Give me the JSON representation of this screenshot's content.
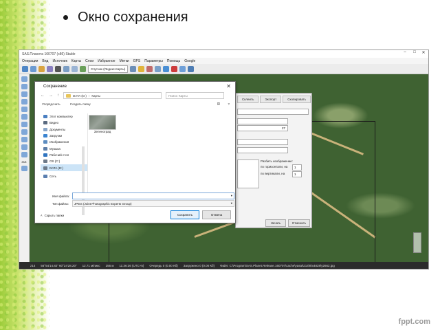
{
  "slide": {
    "title": "Окно сохранения"
  },
  "sas": {
    "window_title": "SAS.Планета 160707 (x86) Stable",
    "menu": [
      "Операции",
      "Вид",
      "Источник",
      "Карты",
      "Слои",
      "Избранное",
      "Метки",
      "GPS",
      "Параметры",
      "Помощь",
      "Google"
    ],
    "map_combo": "Спутник (Яндекс.Карты)",
    "zoom_label": "z14",
    "status": [
      "z14",
      "56°54'14.82\" 60°24'28.20\"",
      "12.71 м/пикс",
      "256 м",
      "11:36:36 (UTC+5)",
      "Очередь 0 (0.00 Кб)",
      "Загружено 0 (0.00 Кб)",
      "Файл: C:\\Program\\SAS.Planet.Release.160707\\cache\\yasat\\z14\\8\\x4828\\y2662.jpg"
    ]
  },
  "panel": {
    "tabs": [
      "Склеить",
      "Экспорт",
      "Скопировать"
    ],
    "split_label": "Разбить изображение:",
    "horiz_label": "по горизонтали, на",
    "vert_label": "по вертикали, на",
    "horiz_value": "1",
    "vert_value": "1",
    "z_value": "27",
    "start_button": "Начать",
    "cancel_button": "Отменить"
  },
  "dialog": {
    "title": "Сохранение",
    "breadcrumb": [
      "DATA (D:)",
      "Карты"
    ],
    "search_placeholder": "Поиск: Карты",
    "organize": "Упорядочить",
    "new_folder": "Создать папку",
    "tree": [
      {
        "label": "Этот компьютер",
        "icon": "computer-icon",
        "color": "#4a7fc1"
      },
      {
        "label": "Видео",
        "icon": "video-icon",
        "color": "#5a6a80"
      },
      {
        "label": "Документы",
        "icon": "documents-icon",
        "color": "#8aa6c8"
      },
      {
        "label": "Загрузки",
        "icon": "downloads-icon",
        "color": "#3a84d1"
      },
      {
        "label": "Изображения",
        "icon": "pictures-icon",
        "color": "#5d8dc0"
      },
      {
        "label": "Музыка",
        "icon": "music-icon",
        "color": "#5e7fa8"
      },
      {
        "label": "Рабочий стол",
        "icon": "desktop-icon",
        "color": "#2f74c0"
      },
      {
        "label": "OS (C:)",
        "icon": "drive-c-icon",
        "color": "#6c7a8a"
      },
      {
        "label": "DATA (D:)",
        "icon": "drive-d-icon",
        "color": "#6c7a8a"
      },
      {
        "label": "Сеть",
        "icon": "network-icon",
        "color": "#5a7fb0"
      }
    ],
    "file": {
      "name": "Зеленоград"
    },
    "filename_label": "Имя файла:",
    "filename_value": "",
    "filetype_label": "Тип файла:",
    "filetype_value": "JPEG (Joint Photographic Experts Group)",
    "hide_folders": "Скрыть папки",
    "save_button": "Сохранить",
    "cancel_button": "Отмена"
  },
  "watermark": "fppt.com"
}
